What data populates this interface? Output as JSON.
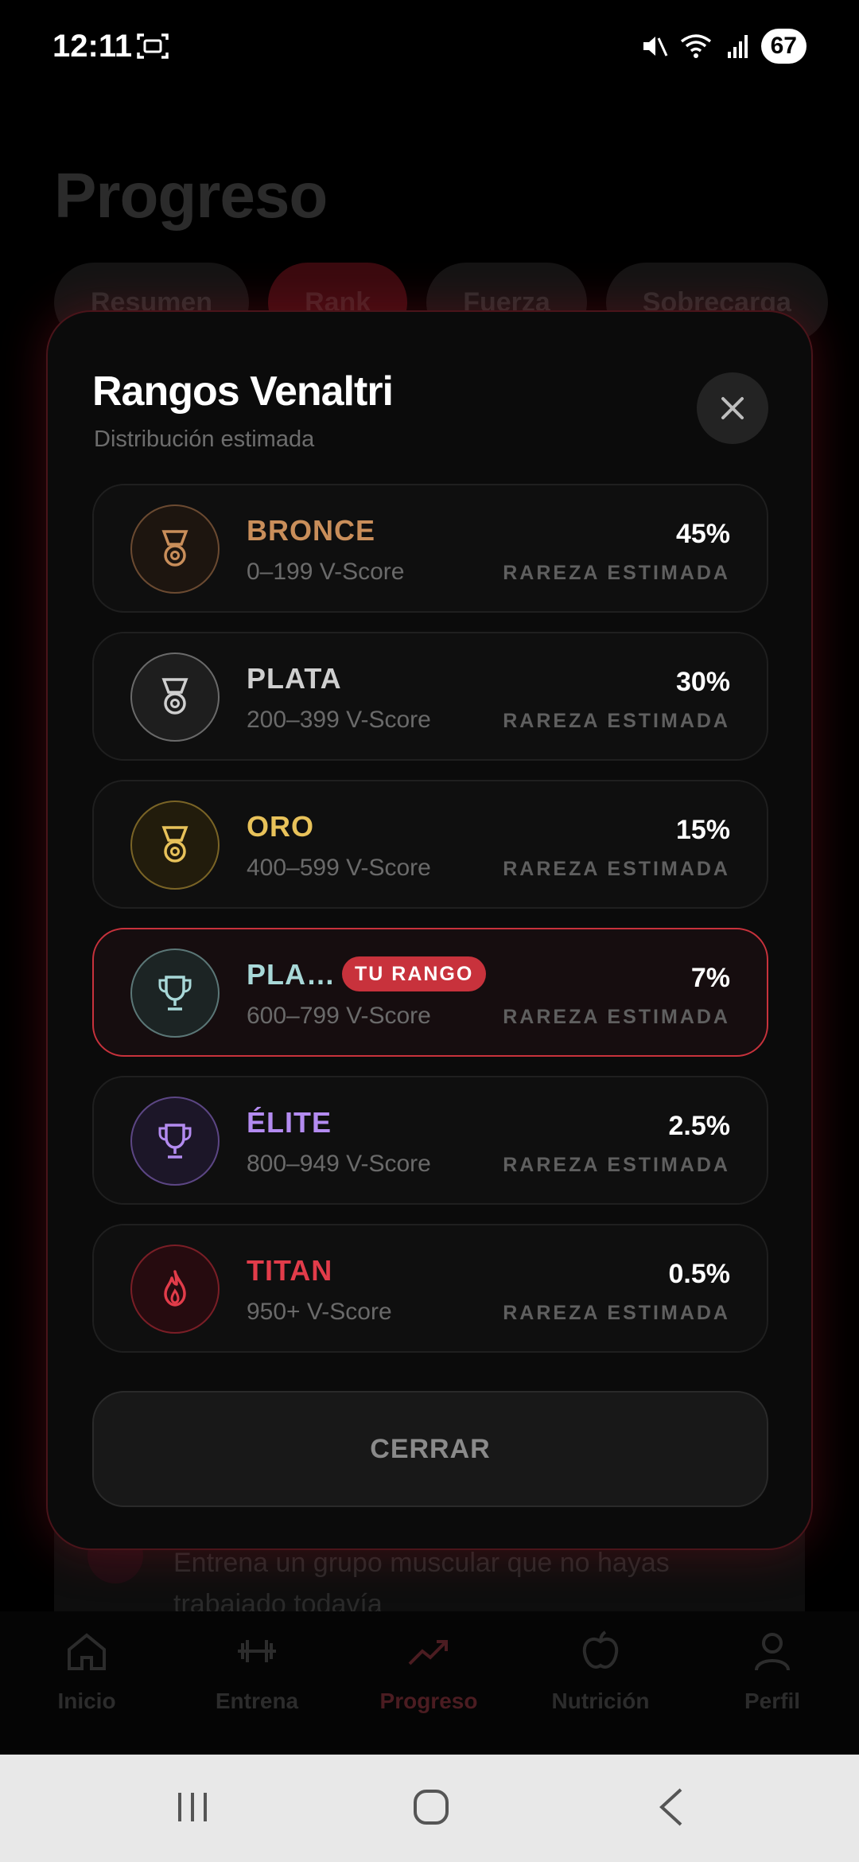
{
  "status_bar": {
    "time": "12:11",
    "battery": "67"
  },
  "background": {
    "title": "Progreso",
    "tabs": [
      {
        "label": "Resumen",
        "active": false
      },
      {
        "label": "Rank",
        "active": true
      },
      {
        "label": "Fuerza",
        "active": false
      },
      {
        "label": "Sobrecarga",
        "active": false
      }
    ],
    "card_text": "Entrena un grupo muscular que no hayas trabajado todavía"
  },
  "bottom_nav": [
    {
      "label": "Inicio",
      "icon": "home-icon",
      "active": false
    },
    {
      "label": "Entrena",
      "icon": "dumbbell-icon",
      "active": false
    },
    {
      "label": "Progreso",
      "icon": "trend-icon",
      "active": true
    },
    {
      "label": "Nutrición",
      "icon": "apple-icon",
      "active": false
    },
    {
      "label": "Perfil",
      "icon": "person-icon",
      "active": false
    }
  ],
  "modal": {
    "title": "Rangos Venaltri",
    "subtitle": "Distribución estimada",
    "close_icon": "close-icon",
    "rarity_label": "RAREZA ESTIMADA",
    "current_badge": "TU RANGO",
    "ranks": [
      {
        "name": "BRONCE",
        "range": "0–199 V-Score",
        "pct": "45%",
        "color": "#c98e5a",
        "icon": "medal-icon",
        "current": false
      },
      {
        "name": "PLATA",
        "range": "200–399 V-Score",
        "pct": "30%",
        "color": "#cfcfcf",
        "icon": "medal-icon",
        "current": false
      },
      {
        "name": "ORO",
        "range": "400–599 V-Score",
        "pct": "15%",
        "color": "#e8c25a",
        "icon": "medal-icon",
        "current": false
      },
      {
        "name": "PLA…",
        "range": "600–799 V-Score",
        "pct": "7%",
        "color": "#a8d8d8",
        "icon": "trophy-icon",
        "current": true
      },
      {
        "name": "ÉLITE",
        "range": "800–949 V-Score",
        "pct": "2.5%",
        "color": "#b38bf0",
        "icon": "trophy-icon",
        "current": false
      },
      {
        "name": "TITAN",
        "range": "950+ V-Score",
        "pct": "0.5%",
        "color": "#e23c4a",
        "icon": "flame-icon",
        "current": false
      }
    ],
    "close_button": "CERRAR"
  }
}
